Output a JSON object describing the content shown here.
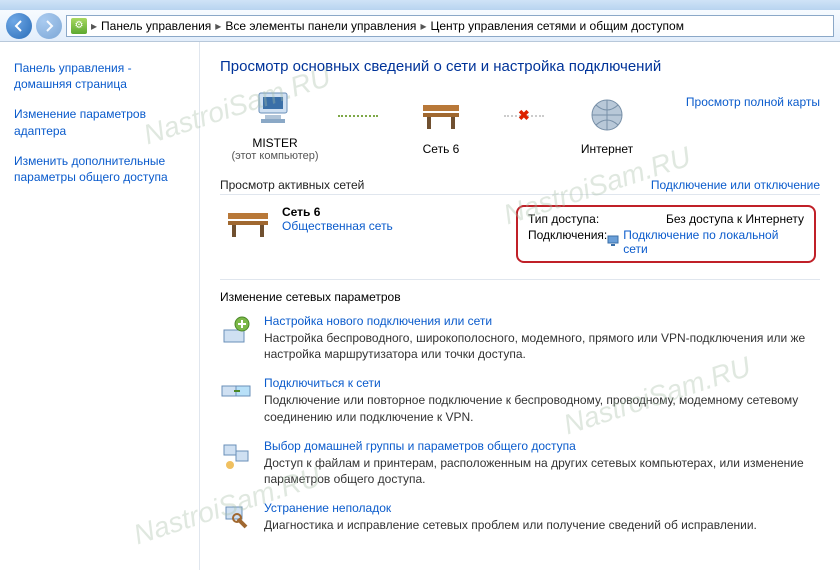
{
  "breadcrumb": {
    "root": "Панель управления",
    "mid": "Все элементы панели управления",
    "leaf": "Центр управления сетями и общим доступом"
  },
  "sidebar": {
    "home": "Панель управления - домашняя страница",
    "adapter": "Изменение параметров адаптера",
    "sharing": "Изменить дополнительные параметры общего доступа"
  },
  "page_title": "Просмотр основных сведений о сети и настройка подключений",
  "fullmap_link": "Просмотр полной карты",
  "map": {
    "computer": {
      "name": "MISTER",
      "sub": "(этот компьютер)"
    },
    "network": {
      "name": "Сеть 6"
    },
    "internet": {
      "name": "Интернет"
    }
  },
  "active_header": "Просмотр активных сетей",
  "connect_toggle": "Подключение или отключение",
  "active_network": {
    "name": "Сеть 6",
    "type": "Общественная сеть",
    "access_label": "Тип доступа:",
    "access_value": "Без доступа к Интернету",
    "conn_label": "Подключения:",
    "conn_value": "Подключение по локальной сети"
  },
  "change_header": "Изменение сетевых параметров",
  "tasks": [
    {
      "title": "Настройка нового подключения или сети",
      "desc": "Настройка беспроводного, широкополосного, модемного, прямого или VPN-подключения или же настройка маршрутизатора или точки доступа."
    },
    {
      "title": "Подключиться к сети",
      "desc": "Подключение или повторное подключение к беспроводному, проводному, модемному сетевому соединению или подключение к VPN."
    },
    {
      "title": "Выбор домашней группы и параметров общего доступа",
      "desc": "Доступ к файлам и принтерам, расположенным на других сетевых компьютерах, или изменение параметров общего доступа."
    },
    {
      "title": "Устранение неполадок",
      "desc": "Диагностика и исправление сетевых проблем или получение сведений об исправлении."
    }
  ],
  "watermark": "NastroiSam.RU"
}
